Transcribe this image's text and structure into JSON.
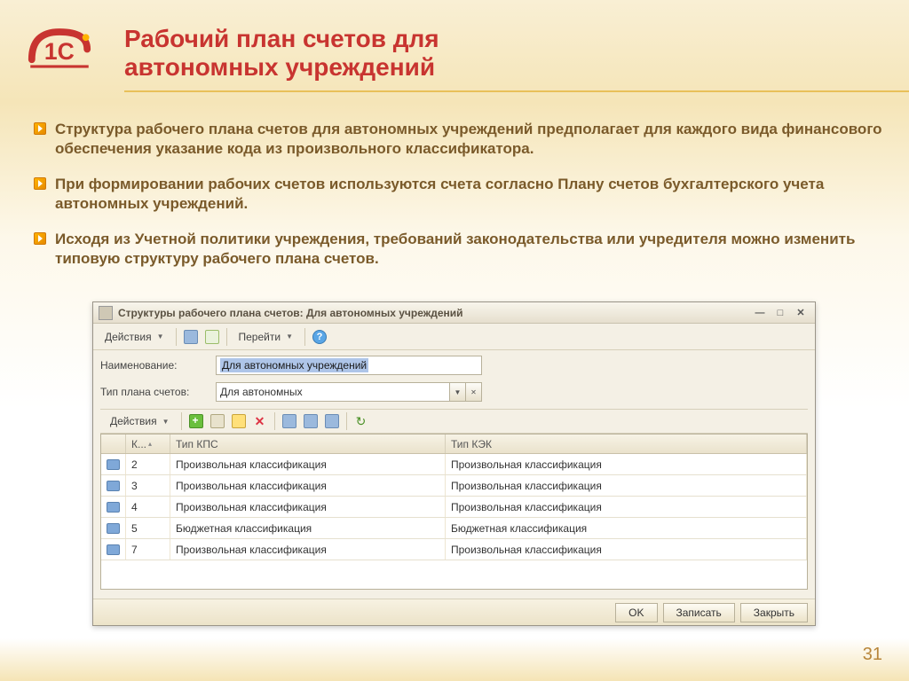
{
  "slide": {
    "title_line1": "Рабочий план счетов для",
    "title_line2": "автономных учреждений",
    "page_number": "31"
  },
  "bullets": [
    "Структура рабочего плана счетов для автономных учреждений предполагает для каждого вида финансового обеспечения указание кода из произвольного классификатора.",
    "При формировании рабочих счетов используются счета согласно Плану счетов бухгалтерского учета автономных учреждений.",
    "Исходя из Учетной политики учреждения, требований законодательства или учредителя можно изменить типовую структуру рабочего плана счетов."
  ],
  "window": {
    "title": "Структуры рабочего плана счетов: Для автономных учреждений",
    "toolbar": {
      "actions_label": "Действия",
      "goto_label": "Перейти"
    },
    "form": {
      "name_label": "Наименование:",
      "name_value": "Для автономных учреждений",
      "plan_type_label": "Тип плана счетов:",
      "plan_type_value": "Для автономных"
    },
    "grid": {
      "actions_label": "Действия",
      "headers": {
        "col1": "К...",
        "col2": "Тип КПС",
        "col3": "Тип КЭК"
      },
      "rows": [
        {
          "code": "2",
          "kps": "Произвольная классификация",
          "kek": "Произвольная классификация"
        },
        {
          "code": "3",
          "kps": "Произвольная классификация",
          "kek": "Произвольная классификация"
        },
        {
          "code": "4",
          "kps": "Произвольная классификация",
          "kek": "Произвольная классификация"
        },
        {
          "code": "5",
          "kps": "Бюджетная классификация",
          "kek": "Бюджетная классификация"
        },
        {
          "code": "7",
          "kps": "Произвольная классификация",
          "kek": "Произвольная классификация"
        }
      ]
    },
    "footer": {
      "ok": "OK",
      "save": "Записать",
      "close": "Закрыть"
    }
  }
}
